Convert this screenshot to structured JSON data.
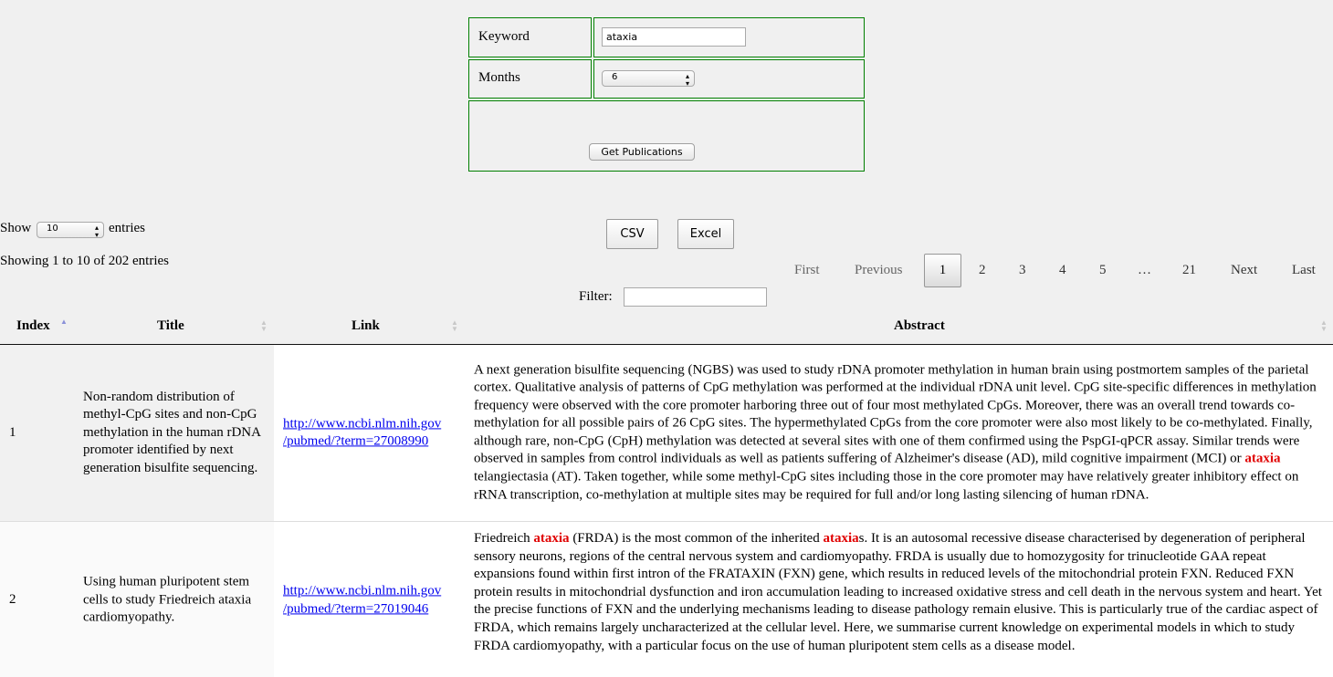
{
  "search": {
    "keyword_label": "Keyword",
    "keyword_value": "ataxia",
    "months_label": "Months",
    "months_value": "6",
    "submit_label": "Get Publications"
  },
  "export": {
    "csv_label": "CSV",
    "excel_label": "Excel"
  },
  "length": {
    "show_label": "Show",
    "value": "10",
    "entries_label": "entries"
  },
  "info": "Showing 1 to 10 of 202 entries",
  "pagination": {
    "first": "First",
    "previous": "Previous",
    "pages": [
      "1",
      "2",
      "3",
      "4",
      "5",
      "…",
      "21"
    ],
    "current": "1",
    "next": "Next",
    "last": "Last"
  },
  "filter": {
    "label": "Filter:",
    "value": ""
  },
  "table": {
    "columns": [
      "Index",
      "Title",
      "Link",
      "Abstract"
    ],
    "rows": [
      {
        "index": "1",
        "title": "Non-random distribution of methyl-CpG sites and non-CpG methylation in the human rDNA promoter identified by next generation bisulfite sequencing.",
        "link_line1": "http://www.ncbi.nlm.nih.gov",
        "link_line2": "/pubmed/?term=27008990",
        "abstract_before": "A next generation bisulfite sequencing (NGBS) was used to study rDNA promoter methylation in human brain using postmortem samples of the parietal cortex. Qualitative analysis of patterns of CpG methylation was performed at the individual rDNA unit level. CpG site-specific differences in methylation frequency were observed with the core promoter harboring three out of four most methylated CpGs. Moreover, there was an overall trend towards co-methylation for all possible pairs of 26 CpG sites. The hypermethylated CpGs from the core promoter were also most likely to be co-methylated. Finally, although rare, non-CpG (CpH) methylation was detected at several sites with one of them confirmed using the PspGI-qPCR assay. Similar trends were observed in samples from control individuals as well as patients suffering of Alzheimer's disease (AD), mild cognitive impairment (MCI) or ",
        "abstract_highlight": "ataxia",
        "abstract_after": " telangiectasia (AT). Taken together, while some methyl-CpG sites including those in the core promoter may have relatively greater inhibitory effect on rRNA transcription, co-methylation at multiple sites may be required for full and/or long lasting silencing of human rDNA."
      },
      {
        "index": "2",
        "title": "Using human pluripotent stem cells to study Friedreich ataxia cardiomyopathy.",
        "link_line1": "http://www.ncbi.nlm.nih.gov",
        "link_line2": "/pubmed/?term=27019046",
        "abstract_a": "Friedreich ",
        "abstract_hl1": "ataxia",
        "abstract_b": " (FRDA) is the most common of the inherited ",
        "abstract_hl2": "ataxia",
        "abstract_c": "s. It is an autosomal recessive disease characterised by degeneration of peripheral sensory neurons, regions of the central nervous system and cardiomyopathy. FRDA is usually due to homozygosity for trinucleotide GAA repeat expansions found within first intron of the FRATAXIN (FXN) gene, which results in reduced levels of the mitochondrial protein FXN. Reduced FXN protein results in mitochondrial dysfunction and iron accumulation leading to increased oxidative stress and cell death in the nervous system and heart. Yet the precise functions of FXN and the underlying mechanisms leading to disease pathology remain elusive. This is particularly true of the cardiac aspect of FRDA, which remains largely uncharacterized at the cellular level. Here, we summarise current knowledge on experimental models in which to study FRDA cardiomyopathy, with a particular focus on the use of human pluripotent stem cells as a disease model."
      }
    ]
  },
  "colors": {
    "border_green": "#008000",
    "highlight": "#e00000",
    "link": "#0000ee"
  }
}
